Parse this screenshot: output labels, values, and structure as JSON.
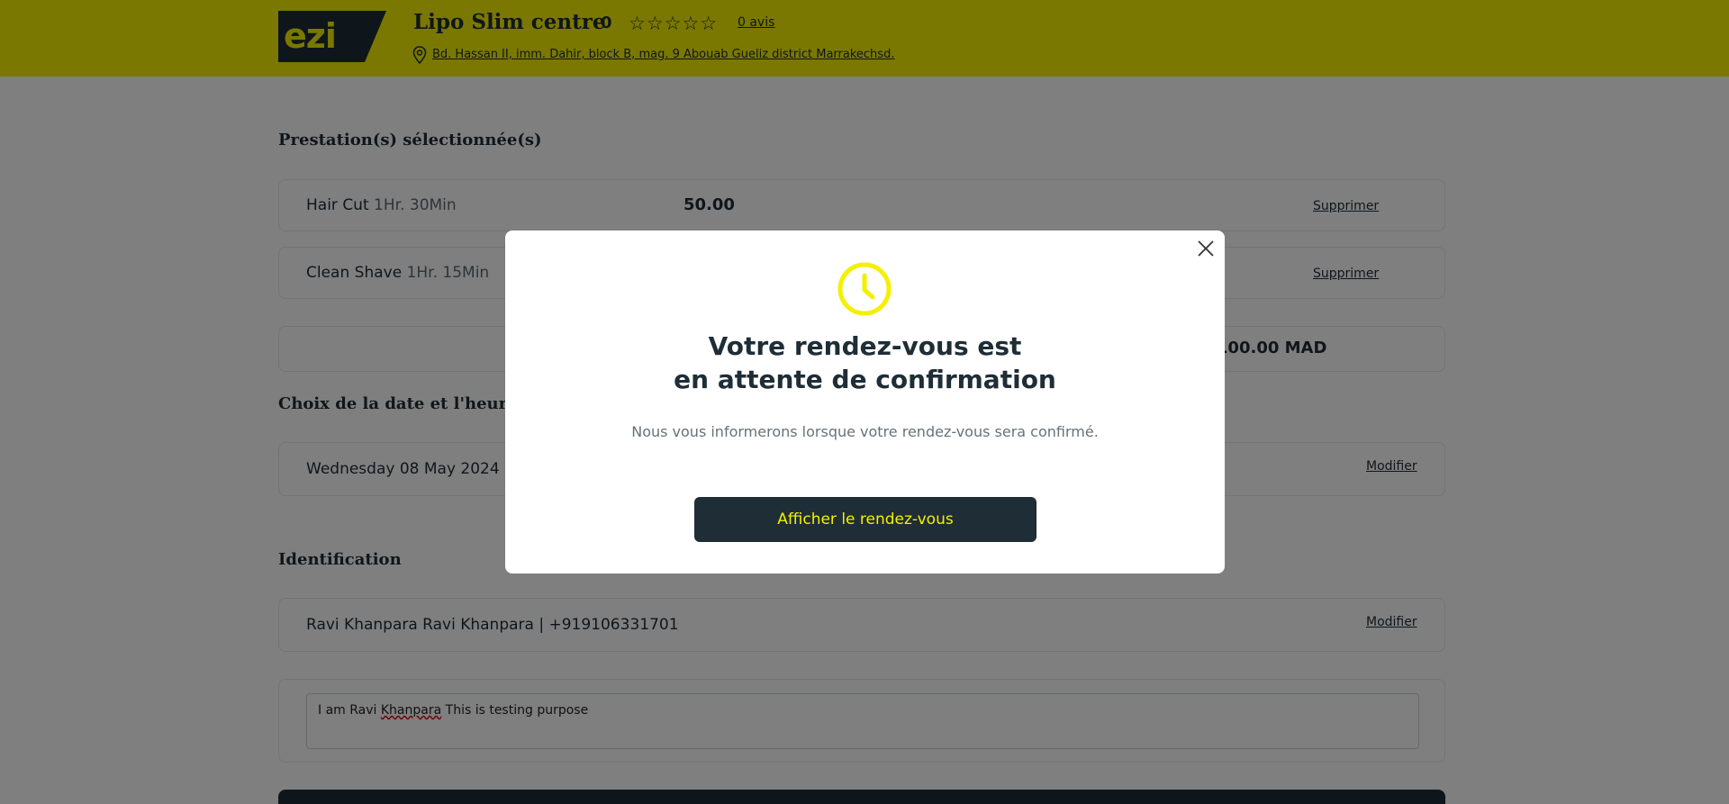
{
  "header": {
    "logo_text": "ezi",
    "business_name": "Lipo Slim centre",
    "rating": "0",
    "stars": "☆☆☆☆☆",
    "reviews_link": "0 avis",
    "address": "Bd. Hassan II, imm. Dahir, block B, mag. 9 Abouab Gueliz district Marrakechsd."
  },
  "services": {
    "title": "Prestation(s) sélectionnée(s)",
    "items": [
      {
        "name": "Hair Cut",
        "duration": "1Hr. 30Min",
        "price": "50.00",
        "remove": "Supprimer"
      },
      {
        "name": "Clean Shave",
        "duration": "1Hr. 15Min",
        "price": "",
        "remove": "Supprimer"
      }
    ],
    "total": "l : 100.00 MAD"
  },
  "datetime": {
    "title": "Choix de la date et l'heure",
    "value": "Wednesday 08 May 2024",
    "edit": "Modifier"
  },
  "identification": {
    "title": "Identification",
    "value": "Ravi Khanpara Ravi Khanpara | +919106331701",
    "edit": "Modifier",
    "note_pre": "I am Ravi ",
    "note_misspelled": "Khanpara",
    "note_post": " This is testing purpose"
  },
  "modal": {
    "title_line1": "Votre rendez-vous est",
    "title_line2": "en attente de confirmation",
    "subtitle": "Nous vous informerons lorsque votre rendez-vous sera confirmé.",
    "button": "Afficher le rendez-vous"
  },
  "colors": {
    "brand_yellow": "#f4f000",
    "dark": "#1e2d36"
  }
}
